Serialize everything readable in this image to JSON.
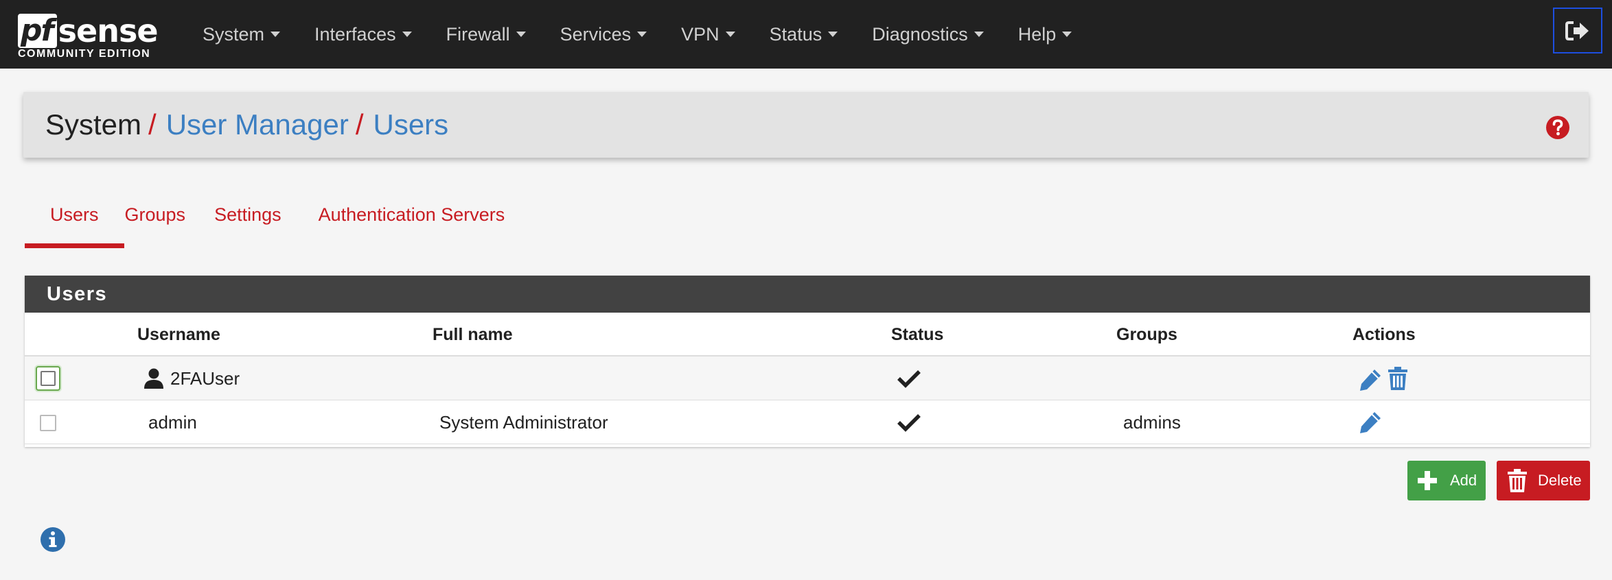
{
  "brand": {
    "logo_pf": "pf",
    "logo_sense": "sense",
    "edition": "COMMUNITY EDITION"
  },
  "nav": {
    "items": [
      {
        "label": "System"
      },
      {
        "label": "Interfaces"
      },
      {
        "label": "Firewall"
      },
      {
        "label": "Services"
      },
      {
        "label": "VPN"
      },
      {
        "label": "Status"
      },
      {
        "label": "Diagnostics"
      },
      {
        "label": "Help"
      }
    ],
    "logout_icon": "sign-out-icon"
  },
  "breadcrumb": {
    "items": [
      {
        "label": "System",
        "link": false
      },
      {
        "label": "User Manager",
        "link": true
      },
      {
        "label": "Users",
        "link": true
      }
    ],
    "separator": "/",
    "help_icon": "question-circle-icon"
  },
  "tabs": [
    {
      "label": "Users",
      "active": true
    },
    {
      "label": "Groups",
      "active": false
    },
    {
      "label": "Settings",
      "active": false
    },
    {
      "label": "Authentication Servers",
      "active": false
    }
  ],
  "users_panel": {
    "title": "Users",
    "columns": [
      "Username",
      "Full name",
      "Status",
      "Groups",
      "Actions"
    ],
    "rows": [
      {
        "username": "2FAUser",
        "full_name": "",
        "status_icon": "check-icon",
        "groups": "",
        "actions": [
          "edit-icon",
          "trash-icon"
        ],
        "user_icon": "user-icon"
      },
      {
        "username": "admin",
        "full_name": "System Administrator",
        "status_icon": "check-icon",
        "groups": "admins",
        "actions": [
          "edit-icon"
        ]
      }
    ]
  },
  "buttons": {
    "add": "Add",
    "delete": "Delete"
  },
  "colors": {
    "navbar": "#212121",
    "accent_red": "#c71c22",
    "link_blue": "#3c7fc2",
    "success_green": "#43a047",
    "panel_header": "#424242"
  }
}
